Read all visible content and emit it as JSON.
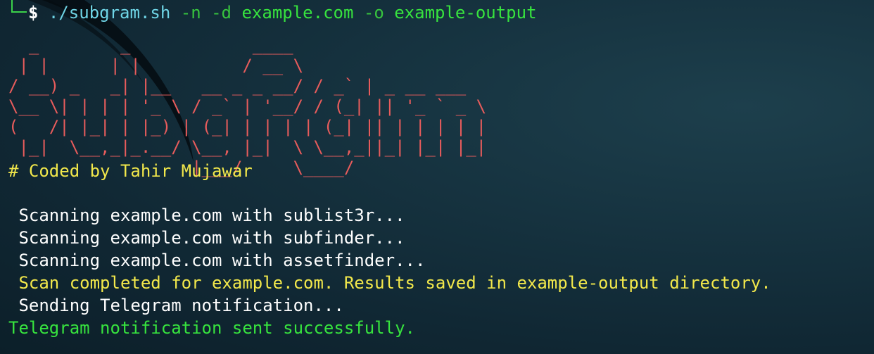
{
  "prompt": {
    "symbol": "$",
    "script": "./subgram.sh",
    "flag_n": "-n",
    "flag_d": "-d",
    "domain": "example.com",
    "flag_o": "-o",
    "output": "example-output"
  },
  "banner": {
    "ascii": "  _        _            ____\n | |      | |          / __ \\\n/ __) _   _| |__   __ _ _ __/ / _` | _ __ ___\n\\__ \\| | | | '_ \\ / _` | '__/ / (_| || '_ ` _ \\\n(   /| |_| | |_) | (_| | | | | (_| || | | | | |\n |_|  \\__,_|_.__/ \\__, |_|  \\ \\__,_||_| |_| |_|\n                  |___/     \\____/",
    "color": "#e85c5c"
  },
  "credit": "# Coded by Tahir Mujawar",
  "output_lines": [
    " Scanning example.com with sublist3r...",
    " Scanning example.com with subfinder...",
    " Scanning example.com with assetfinder...",
    " Scan completed for example.com. Results saved in example-output directory.",
    " Sending Telegram notification...",
    "Telegram notification sent successfully."
  ],
  "colors": {
    "background": "#102733",
    "prompt_green": "#37c43e",
    "script_cyan": "#6fd5e6",
    "banner_red": "#e85c5c",
    "info_yellow": "#f2e84b",
    "success_green": "#37e33e",
    "text_white": "#ffffff"
  }
}
